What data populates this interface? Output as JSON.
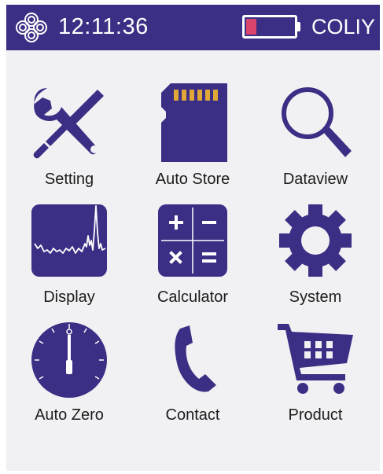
{
  "status_bar": {
    "time": "12:11:36",
    "brand": "COLIY",
    "battery_level": 0.22
  },
  "colors": {
    "primary": "#3b2f85",
    "battery_low": "#d9456b",
    "background": "#f1f1f3"
  },
  "apps": [
    {
      "label": "Setting",
      "icon": "wrench-screwdriver-icon"
    },
    {
      "label": "Auto Store",
      "icon": "sd-card-icon"
    },
    {
      "label": "Dataview",
      "icon": "magnifier-icon"
    },
    {
      "label": "Display",
      "icon": "spectrum-display-icon"
    },
    {
      "label": "Calculator",
      "icon": "calculator-icon"
    },
    {
      "label": "System",
      "icon": "gear-icon"
    },
    {
      "label": "Auto Zero",
      "icon": "dial-gauge-icon"
    },
    {
      "label": "Contact",
      "icon": "phone-handset-icon"
    },
    {
      "label": "Product",
      "icon": "shopping-cart-icon"
    }
  ]
}
